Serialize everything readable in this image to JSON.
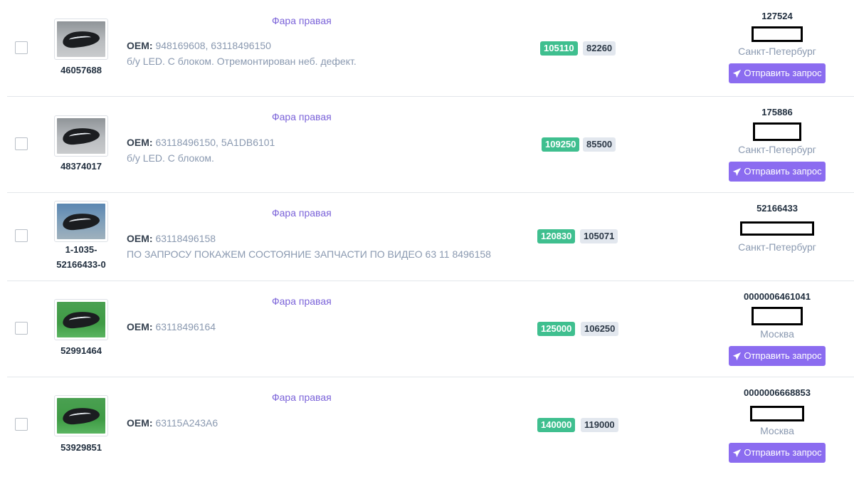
{
  "send_request_label": "Отправить запрос",
  "oem_label": "OEM:",
  "rows": [
    {
      "id": "46057688",
      "title": "Фара правая",
      "oem": "948169608, 63118496150",
      "description": "б/у LED. С блоком. Отремонтирован неб. дефект.",
      "price_main": "105110",
      "price_alt": "82260",
      "seller_id": "127524",
      "city": "Санкт-Петербург",
      "has_button": true,
      "image": "gray"
    },
    {
      "id": "48374017",
      "title": "Фара правая",
      "oem": "63118496150, 5A1DB6101",
      "description": "б/у LED. С блоком.",
      "price_main": "109250",
      "price_alt": "85500",
      "seller_id": "175886",
      "city": "Санкт-Петербург",
      "has_button": true,
      "image": "gray"
    },
    {
      "id_line1": "1-1035-",
      "id_line2": "52166433-0",
      "title": "Фара правая",
      "oem": "63118496158",
      "description": "ПО ЗАПРОСУ ПОКАЖЕМ СОСТОЯНИЕ ЗАПЧАСТИ ПО ВИДЕО 63 11 8496158",
      "price_main": "120830",
      "price_alt": "105071",
      "seller_id": "52166433",
      "city": "Санкт-Петербург",
      "has_button": false,
      "image": "blue"
    },
    {
      "id": "52991464",
      "title": "Фара правая",
      "oem": "63118496164",
      "description": "",
      "price_main": "125000",
      "price_alt": "106250",
      "seller_id": "0000006461041",
      "city": "Москва",
      "has_button": true,
      "image": "green"
    },
    {
      "id": "53929851",
      "title": "Фара правая",
      "oem": "63115A243A6",
      "description": "",
      "price_main": "140000",
      "price_alt": "119000",
      "seller_id": "0000006668853",
      "city": "Москва",
      "has_button": true,
      "image": "green"
    }
  ]
}
